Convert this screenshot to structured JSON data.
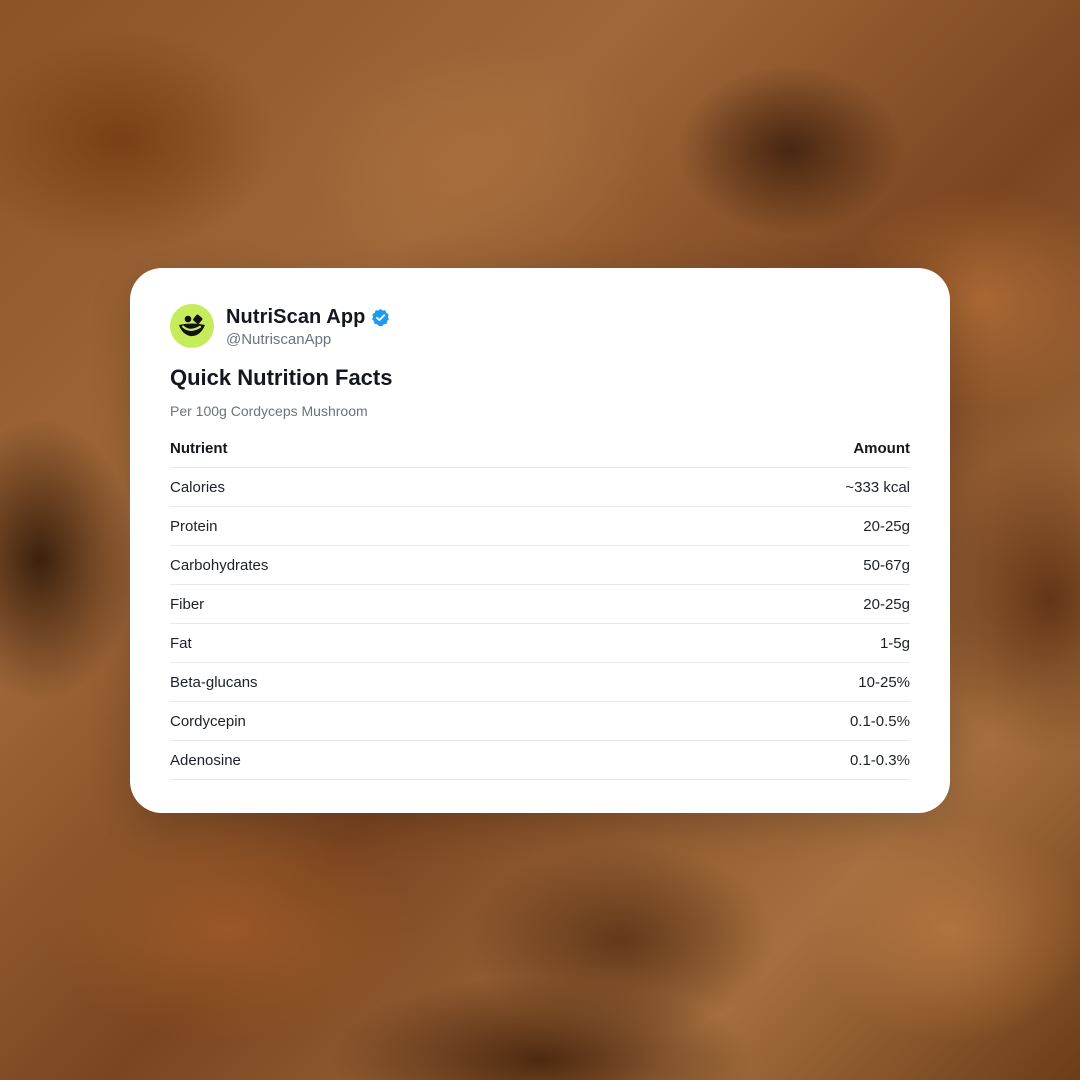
{
  "profile": {
    "name": "NutriScan App",
    "handle": "@NutriscanApp",
    "verified_icon": "verified-badge-icon",
    "avatar_icon": "nutriscan-logo-icon",
    "avatar_color": "#c7ec5b",
    "verified_color": "#1d9bf0"
  },
  "card": {
    "title": "Quick Nutrition Facts",
    "subtitle": "Per 100g Cordyceps Mushroom"
  },
  "table": {
    "headers": {
      "nutrient": "Nutrient",
      "amount": "Amount"
    },
    "rows": [
      {
        "nutrient": "Calories",
        "amount": "~333 kcal"
      },
      {
        "nutrient": "Protein",
        "amount": "20-25g"
      },
      {
        "nutrient": "Carbohydrates",
        "amount": "50-67g"
      },
      {
        "nutrient": "Fiber",
        "amount": "20-25g"
      },
      {
        "nutrient": "Fat",
        "amount": "1-5g"
      },
      {
        "nutrient": "Beta-glucans",
        "amount": "10-25%"
      },
      {
        "nutrient": "Cordycepin",
        "amount": "0.1-0.5%"
      },
      {
        "nutrient": "Adenosine",
        "amount": "0.1-0.3%"
      }
    ]
  }
}
